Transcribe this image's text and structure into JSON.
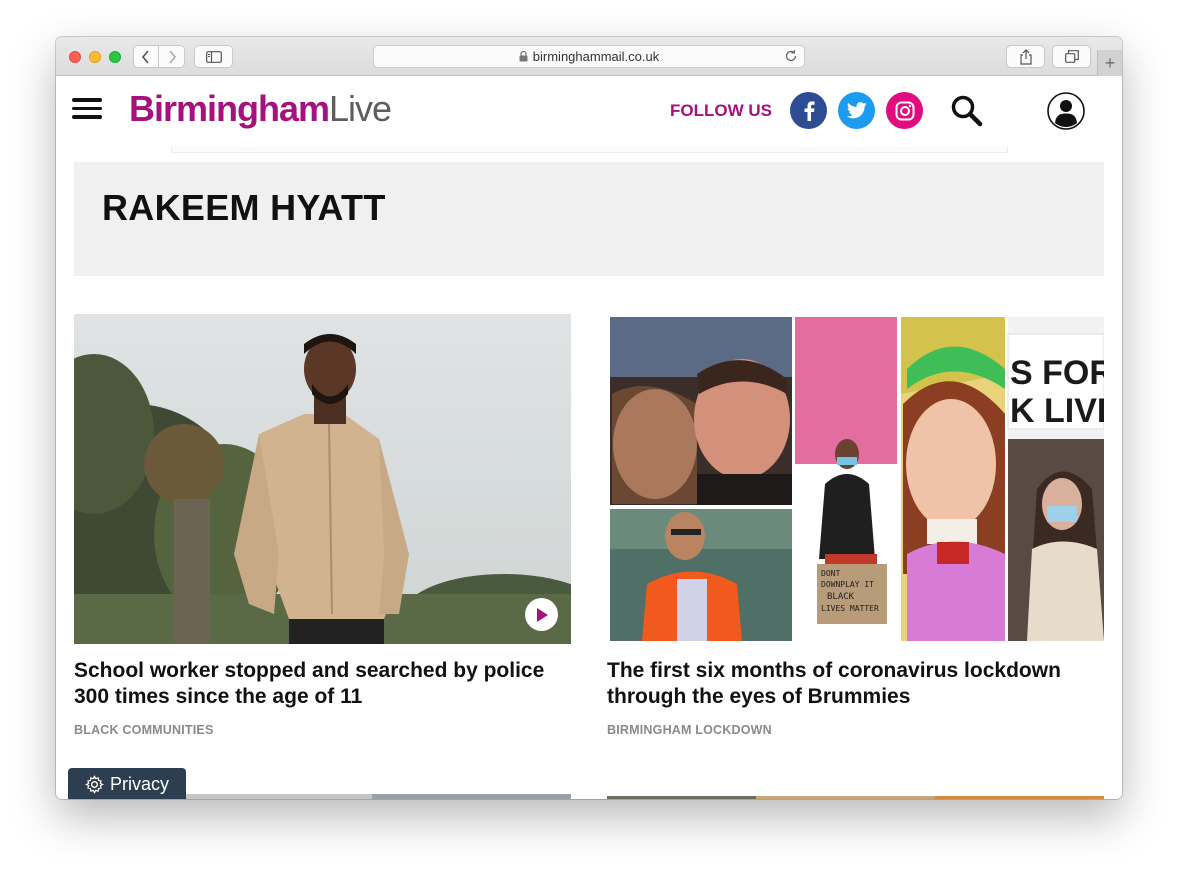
{
  "browser": {
    "url": "birminghammail.co.uk"
  },
  "header": {
    "logo_part1": "Birmingham",
    "logo_part2": "Live",
    "follow_label": "FOLLOW US"
  },
  "author": {
    "name": "RAKEEM HYATT"
  },
  "articles": [
    {
      "title": "School worker stopped and searched by police 300 times since the age of 11",
      "tag": "BLACK COMMUNITIES"
    },
    {
      "title": "The first six months of coronavirus lockdown through the eyes of Brummies",
      "tag": "BIRMINGHAM LOCKDOWN"
    }
  ],
  "photo_signs": {
    "sign_line1": "DONT",
    "sign_line2": "DOWNPLAY IT",
    "sign_line3": "BLACK",
    "sign_line4": "LIVES MATTER",
    "banner_line1": "S FOR",
    "banner_line2": "K LIVE"
  },
  "privacy": {
    "label": "Privacy"
  },
  "colors": {
    "brand": "#a6117e",
    "facebook": "#2c4c93",
    "twitter": "#1d9bf0",
    "instagram": "#e30b80",
    "privacy_bg": "#2d3e50"
  }
}
